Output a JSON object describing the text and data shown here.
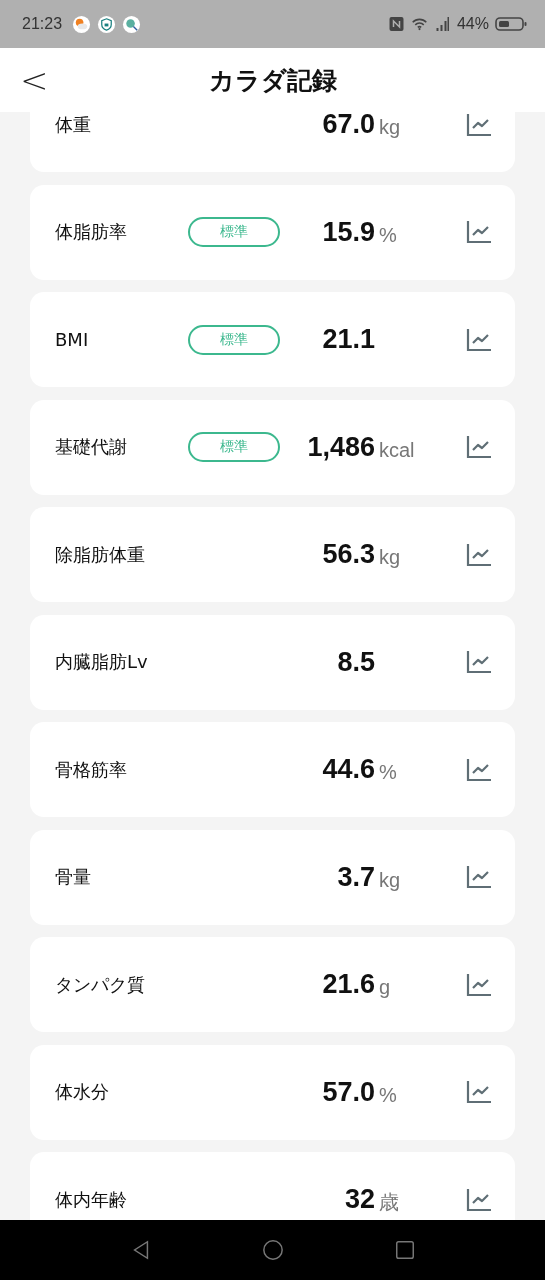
{
  "status_bar": {
    "time": "21:23",
    "battery": "44%"
  },
  "header": {
    "title": "カラダ記録",
    "back": "<"
  },
  "metrics": [
    {
      "label": "体重",
      "value": "67.0",
      "unit": "kg"
    },
    {
      "label": "体脂肪率",
      "badge": "標準",
      "value": "15.9",
      "unit": "%"
    },
    {
      "label": "BMI",
      "badge": "標準",
      "value": "21.1"
    },
    {
      "label": "基礎代謝",
      "badge": "標準",
      "value": "1,486",
      "unit": "kcal"
    },
    {
      "label": "除脂肪体重",
      "value": "56.3",
      "unit": "kg"
    },
    {
      "label": "内臓脂肪Lv",
      "value": "8.5"
    },
    {
      "label": "骨格筋率",
      "value": "44.6",
      "unit": "%"
    },
    {
      "label": "骨量",
      "value": "3.7",
      "unit": "kg"
    },
    {
      "label": "タンパク質",
      "value": "21.6",
      "unit": "g"
    },
    {
      "label": "体水分",
      "value": "57.0",
      "unit": "%"
    },
    {
      "label": "体内年齢",
      "value": "32",
      "unit": "歳"
    }
  ]
}
